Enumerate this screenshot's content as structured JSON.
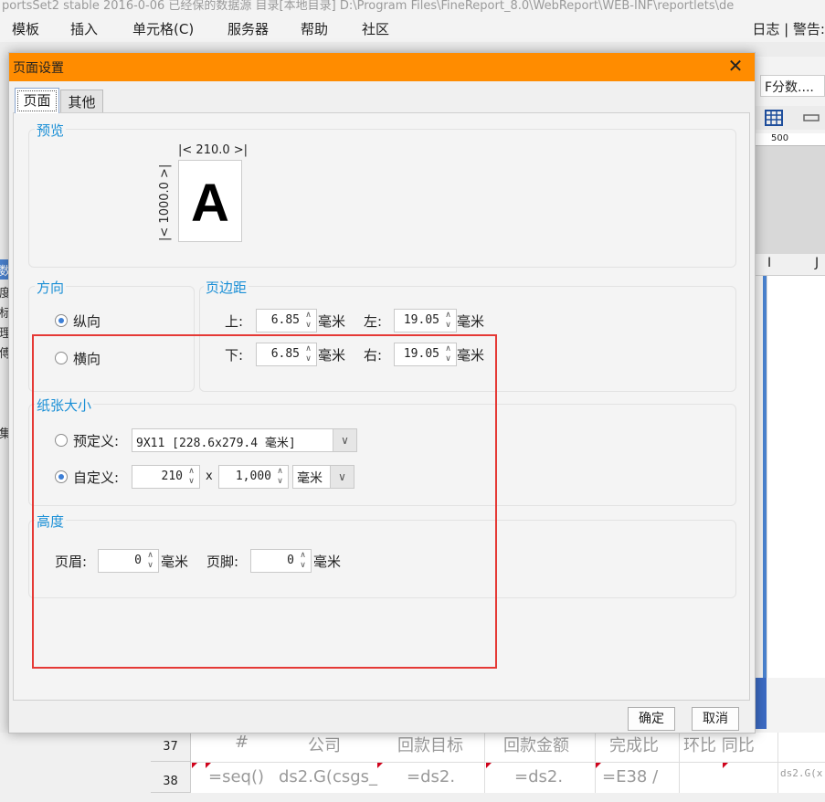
{
  "app": {
    "title_strip": "portsSet2 stable 2016-0-06 已经保的数据源 目录[本地目录] D:\\Program Files\\FineReport_8.0\\WebReport\\WEB-INF\\reportlets\\de",
    "menu": [
      "模板",
      "插入",
      "单元格(C)",
      "服务器",
      "帮助",
      "社区"
    ],
    "menu_right": "日志 | 警告:",
    "formula_box": "F分数....",
    "ruler_mark": "500",
    "col_headers": [
      "I",
      "J"
    ],
    "side_chars": [
      "数",
      "度",
      "标",
      "理",
      "傅",
      "集"
    ],
    "rows": [
      {
        "num": "37",
        "cells": [
          "#",
          "公司",
          "回款目标",
          "回款金额",
          "完成比",
          "环比 同比"
        ]
      },
      {
        "num": "38",
        "cells": [
          "=seq()",
          "ds2.G(csgs_",
          "=ds2.",
          "=ds2.",
          "=E38 /",
          "ds2.G(x"
        ]
      }
    ]
  },
  "dialog": {
    "title": "页面设置",
    "close_icon": "close-icon",
    "tabs": [
      {
        "label": "页面",
        "active": true
      },
      {
        "label": "其他",
        "active": false
      }
    ],
    "preview": {
      "label": "预览",
      "width_text": "210.0",
      "height_text": "1000.0",
      "glyph": "A"
    },
    "orientation": {
      "label": "方向",
      "portrait": "纵向",
      "landscape": "横向",
      "selected": "portrait"
    },
    "margins": {
      "label": "页边距",
      "top_label": "上:",
      "top_value": "6.85",
      "bottom_label": "下:",
      "bottom_value": "6.85",
      "left_label": "左:",
      "left_value": "19.05",
      "right_label": "右:",
      "right_value": "19.05",
      "unit": "毫米"
    },
    "paper": {
      "label": "纸张大小",
      "predefined_label": "预定义:",
      "predefined_value": "9X11 [228.6x279.4 毫米]",
      "custom_label": "自定义:",
      "custom_width": "210",
      "times": "x",
      "custom_height": "1,000",
      "unit_value": "毫米",
      "selected": "custom"
    },
    "height": {
      "label": "高度",
      "header_label": "页眉:",
      "header_value": "0",
      "footer_label": "页脚:",
      "footer_value": "0",
      "unit": "毫米"
    },
    "buttons": {
      "ok": "确定",
      "cancel": "取消"
    },
    "highlight_color": "#e53935",
    "title_bar_color": "#ff8c00",
    "accent_color": "#1a8fd6"
  }
}
